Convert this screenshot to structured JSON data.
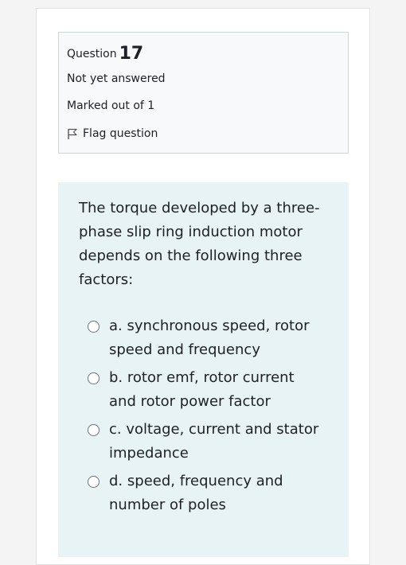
{
  "question": {
    "label": "Question",
    "number": "17",
    "state": "Not yet answered",
    "grade": "Marked out of 1",
    "flag_label": "Flag question"
  },
  "content": {
    "text": "The torque developed by a three-phase slip ring induction motor depends on the following three factors:",
    "options": [
      {
        "letter": "a.",
        "text": "synchronous speed, rotor speed and frequency"
      },
      {
        "letter": "b.",
        "text": "rotor emf, rotor current and rotor power factor"
      },
      {
        "letter": "c.",
        "text": "voltage, current and stator impedance"
      },
      {
        "letter": "d.",
        "text": "speed, frequency and number of poles"
      }
    ]
  },
  "icons": {
    "flag": "flag-icon",
    "radio": "radio-icon"
  },
  "colors": {
    "info_bg": "#f8f9fa",
    "info_border": "#cfd4da",
    "content_bg": "#e7f3f5"
  }
}
